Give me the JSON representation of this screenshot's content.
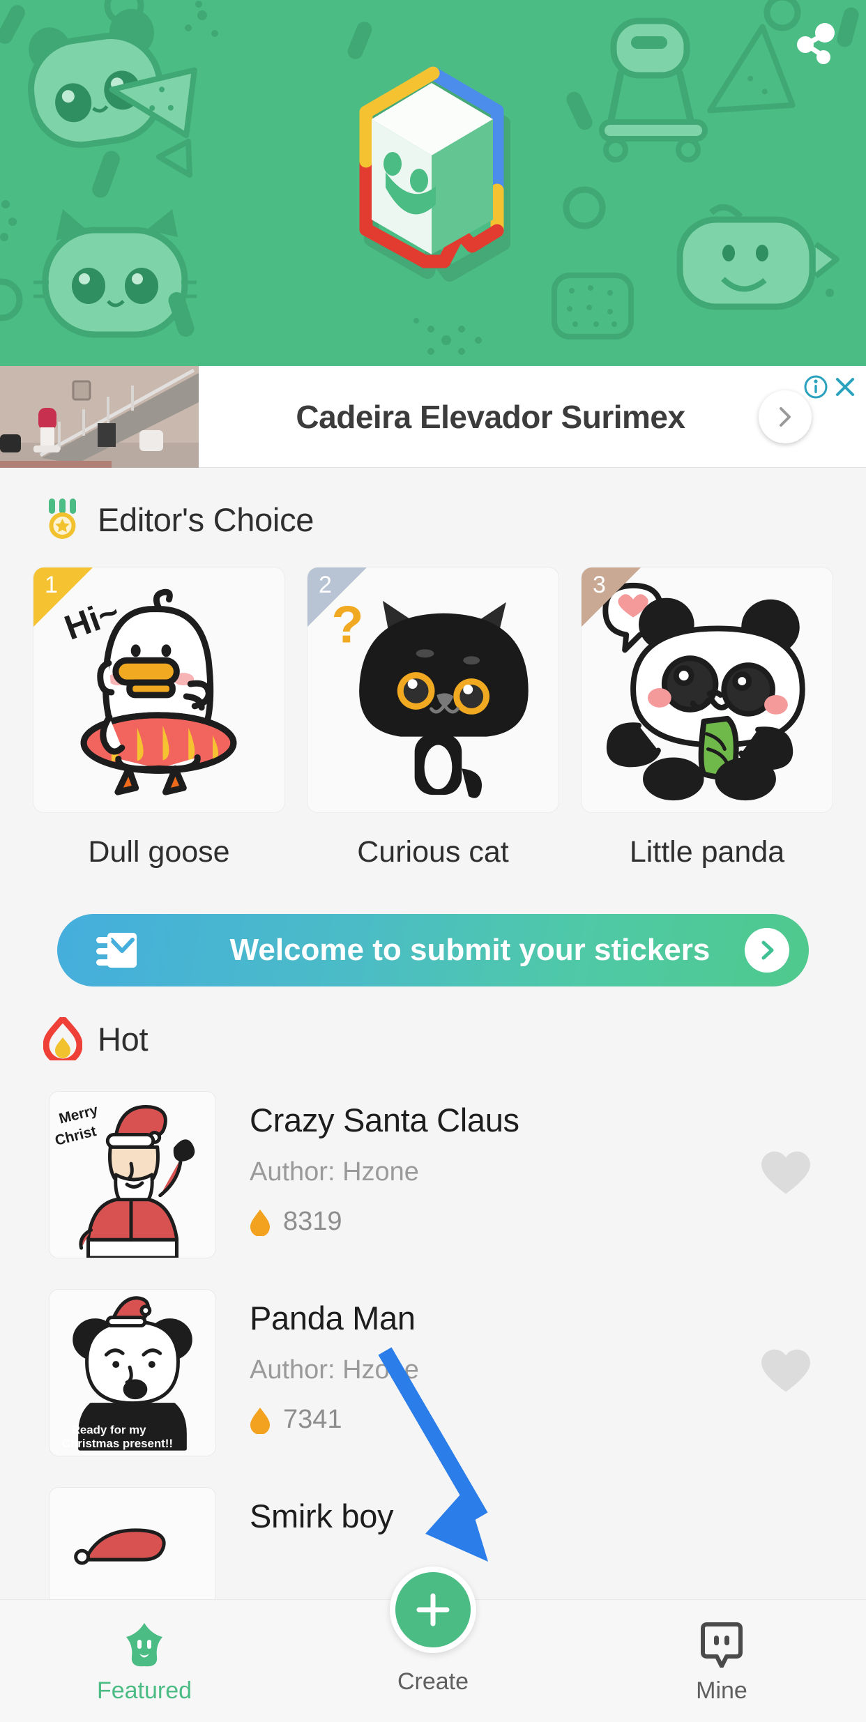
{
  "hero": {
    "share_icon": "share-icon",
    "logo_icon": "cube-smiley-logo",
    "bg_color": "#4CBC85"
  },
  "ad": {
    "title": "Cadeira Elevador Surimex",
    "info_icon": "info-icon",
    "close_icon": "close-icon",
    "cta_icon": "chevron-right-icon",
    "accent_color": "#2AA2BE"
  },
  "editors_choice": {
    "title": "Editor's Choice",
    "icon": "medal-star-icon",
    "items": [
      {
        "rank": "1",
        "name": "Dull goose",
        "ribbon_color": "#F5C231",
        "art": "white-duck-swim-ring"
      },
      {
        "rank": "2",
        "name": "Curious cat",
        "ribbon_color": "#B8C4D4",
        "art": "black-cat-question-mark"
      },
      {
        "rank": "3",
        "name": "Little panda",
        "ribbon_color": "#C9A894",
        "art": "panda-heart-bamboo"
      }
    ]
  },
  "submit_banner": {
    "label": "Welcome to submit your stickers",
    "icon": "envelope-icon",
    "arrow_icon": "chevron-right-icon",
    "gradient_from": "#45AEDD",
    "gradient_to": "#4FC98C"
  },
  "hot": {
    "title": "Hot",
    "icon": "flame-icon",
    "items": [
      {
        "name": "Crazy Santa Claus",
        "author": "Author: Hzone",
        "count": "8319",
        "flame_icon": "flame-icon",
        "heart_icon": "heart-icon",
        "art": "santa-merry-christmas"
      },
      {
        "name": "Panda Man",
        "author": "Author: Hzone",
        "count": "7341",
        "flame_icon": "flame-icon",
        "heart_icon": "heart-icon",
        "art": "panda-santa-hat"
      },
      {
        "name": "Smirk boy",
        "author": "",
        "count": "",
        "flame_icon": "flame-icon",
        "heart_icon": "heart-icon",
        "art": "santa-hat-partial"
      }
    ]
  },
  "bottom_nav": {
    "items": [
      {
        "label": "Featured",
        "icon": "star-face-icon",
        "active": true
      },
      {
        "label": "Create",
        "icon": "plus-icon",
        "active": false
      },
      {
        "label": "Mine",
        "icon": "speech-bubble-face-icon",
        "active": false
      }
    ],
    "active_color": "#4CBC85"
  },
  "annotation": {
    "arrow_color": "#2B7DE9",
    "points_to": "Create"
  }
}
